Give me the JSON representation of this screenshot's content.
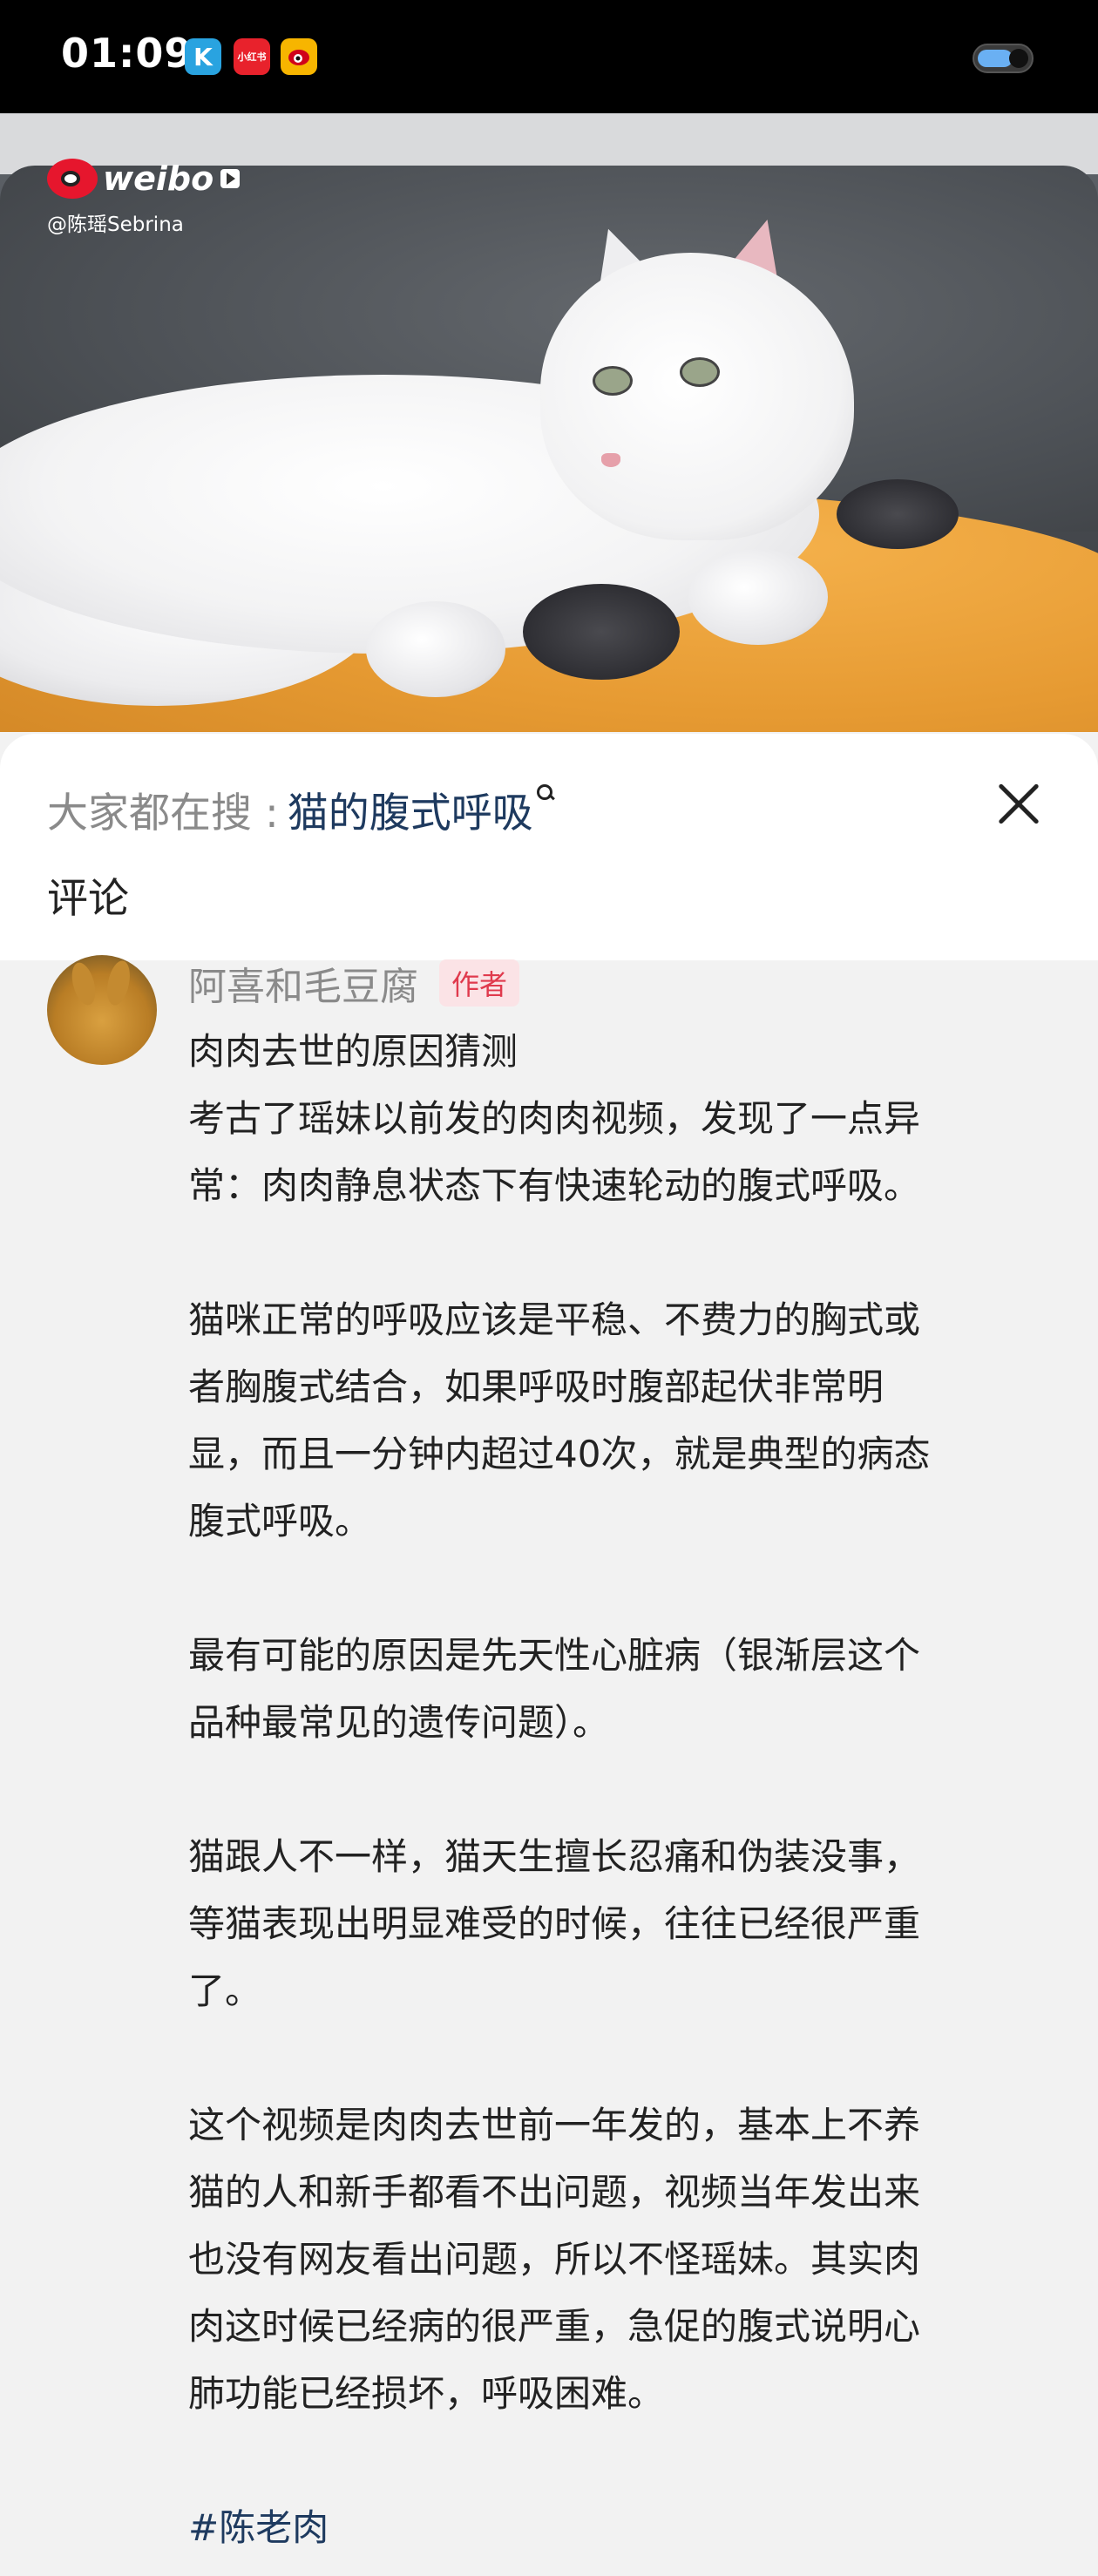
{
  "status_bar": {
    "time": "01:09",
    "app_icons": [
      "k-app-icon",
      "xiaohongshu-icon",
      "weibo-app-icon"
    ],
    "app_badge_text": [
      "K",
      "小红书",
      ""
    ]
  },
  "video": {
    "watermark_logo_text": "weibo",
    "watermark_handle": "@陈瑶Sebrina"
  },
  "panel": {
    "search_prefix": "大家都在搜 :",
    "search_term": "猫的腹式呼吸",
    "section_title": "评论"
  },
  "comment": {
    "author": "阿喜和毛豆腐",
    "author_tag": "作者",
    "lines": [
      "肉肉去世的原因猜测",
      "考古了瑶妹以前发的肉肉视频，发现了一点异",
      "常：肉肉静息状态下有快速轮动的腹式呼吸。",
      "",
      "猫咪正常的呼吸应该是平稳、不费力的胸式或",
      "者胸腹式结合，如果呼吸时腹部起伏非常明",
      "显，而且一分钟内超过40次，就是典型的病态",
      "腹式呼吸。",
      "",
      "最有可能的原因是先天性心脏病（银渐层这个",
      "品种最常见的遗传问题）。",
      "",
      "猫跟人不一样，猫天生擅长忍痛和伪装没事，",
      "等猫表现出明显难受的时候，往往已经很严重",
      "了。",
      "",
      "这个视频是肉肉去世前一年发的，基本上不养",
      "猫的人和新手都看不出问题，视频当年发出来",
      "也没有网友看出问题，所以不怪瑶妹。其实肉",
      "肉这时候已经病的很严重，急促的腹式说明心",
      "肺功能已经损坏，呼吸困难。",
      ""
    ],
    "hashtag": "#陈老肉"
  },
  "colors": {
    "link": "#1e3a5f",
    "author_tag_bg": "#fbe3e6",
    "author_tag_fg": "#e03a4d",
    "background": "#f2f2f2"
  }
}
